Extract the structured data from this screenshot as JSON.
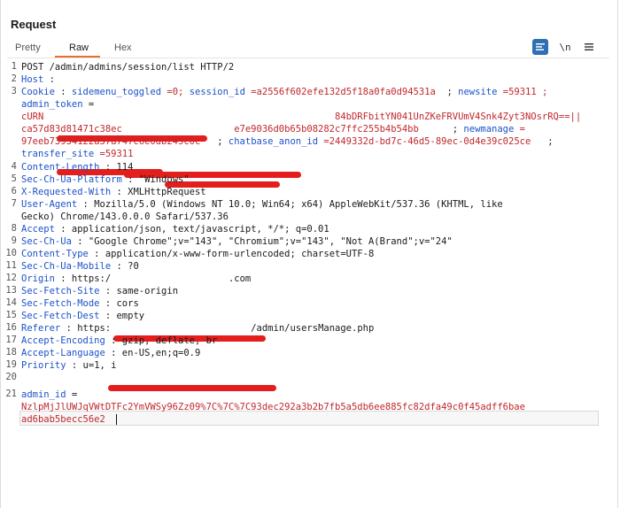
{
  "title": "Request",
  "tabs": [
    "Pretty",
    "Raw",
    "Hex"
  ],
  "toolbar": {
    "pretty_print_icon": "list-icon",
    "newline_label": "\\n",
    "menu_icon": "hamburger-icon"
  },
  "lines": {
    "l1": "POST /admin/admins/session/list HTTP/2",
    "host_key": "Host",
    "cookie_key": "Cookie",
    "c_sidemenu_k": "sidemenu_toggled",
    "c_sidemenu_v": "=0;",
    "c_session_k": "session_id",
    "c_session_v": "=a2556f602efe132d5f18a0fa0d94531a",
    "c_newsite_k": "newsite",
    "c_newsite_v": "=59311 ;",
    "admin_token_k": "admin_token",
    "admin_token_eq": " =",
    "admin_token_v1": "cURN                                                    84bDRFbitYN041UnZKeFRVUmV4Snk4Zyt3NOsrRQ==||",
    "admin_token_v2": "ca57d83d81471c38ec                    e7e9036d0b65b08282c7ffc255b4b54bb",
    "c_newmanage_k": "newmanage",
    "c_newmanage_v": "=",
    "admin_token_v3": "97eeb73934122a37a747c6e0db245c0c",
    "c_chatbase_k": "chatbase_anon_id",
    "c_chatbase_v": "=2449332d-bd7c-46d5-89ec-0d4e39c025ce",
    "c_transfer_k": "transfer_site",
    "c_transfer_v": "=59311",
    "content_length_k": "Content-Length",
    "content_length_v": "114",
    "sec_platform_k": "Sec-Ch-Ua-Platform",
    "sec_platform_v": "\"Windows\"",
    "xrw_k": "X-Requested-With",
    "xrw_v": "XMLHttpRequest",
    "ua_k": "User-Agent",
    "ua_v1": "Mozilla/5.0 (Windows NT 10.0; Win64; x64) AppleWebKit/537.36 (KHTML, like",
    "ua_v2": "Gecko) Chrome/143.0.0.0 Safari/537.36",
    "accept_k": "Accept",
    "accept_v": "application/json, text/javascript, */*; q=0.01",
    "sec_ua_k": "Sec-Ch-Ua",
    "sec_ua_v": "\"Google Chrome\";v=\"143\", \"Chromium\";v=\"143\", \"Not A(Brand\";v=\"24\"",
    "ctype_k": "Content-Type",
    "ctype_v": "application/x-www-form-urlencoded; charset=UTF-8",
    "mobile_k": "Sec-Ch-Ua-Mobile",
    "mobile_v": "?0",
    "origin_k": "Origin",
    "origin_v1": "https:/",
    "origin_v2": ".com",
    "fsite_k": "Sec-Fetch-Site",
    "fsite_v": "same-origin",
    "fmode_k": "Sec-Fetch-Mode",
    "fmode_v": "cors",
    "fdest_k": "Sec-Fetch-Dest",
    "fdest_v": "empty",
    "referer_k": "Referer",
    "referer_v1": "https:",
    "referer_v2": "/admin/usersManage.php",
    "aenc_k": "Accept-Encoding",
    "aenc_v": "gzip, deflate, br",
    "alang_k": "Accept-Language",
    "alang_v": "en-US,en;q=0.9",
    "prio_k": "Priority",
    "prio_v": "u=1, i",
    "body_k": "admin_id",
    "body_eq": " =",
    "body_v1": "NzlpMjJlUWJqVWtDTFc2YmVWSy96Zz09%7C%7C%7C93dec292a3b2b7fb5a5db6ee885fc82dfa49c0f45adff6bae",
    "body_v2": "ad6bab5becc56e2"
  },
  "line_numbers": [
    "1",
    "2",
    "3",
    "4",
    "5",
    "6",
    "7",
    "8",
    "9",
    "10",
    "11",
    "12",
    "13",
    "14",
    "15",
    "16",
    "17",
    "18",
    "19",
    "20",
    "21"
  ]
}
